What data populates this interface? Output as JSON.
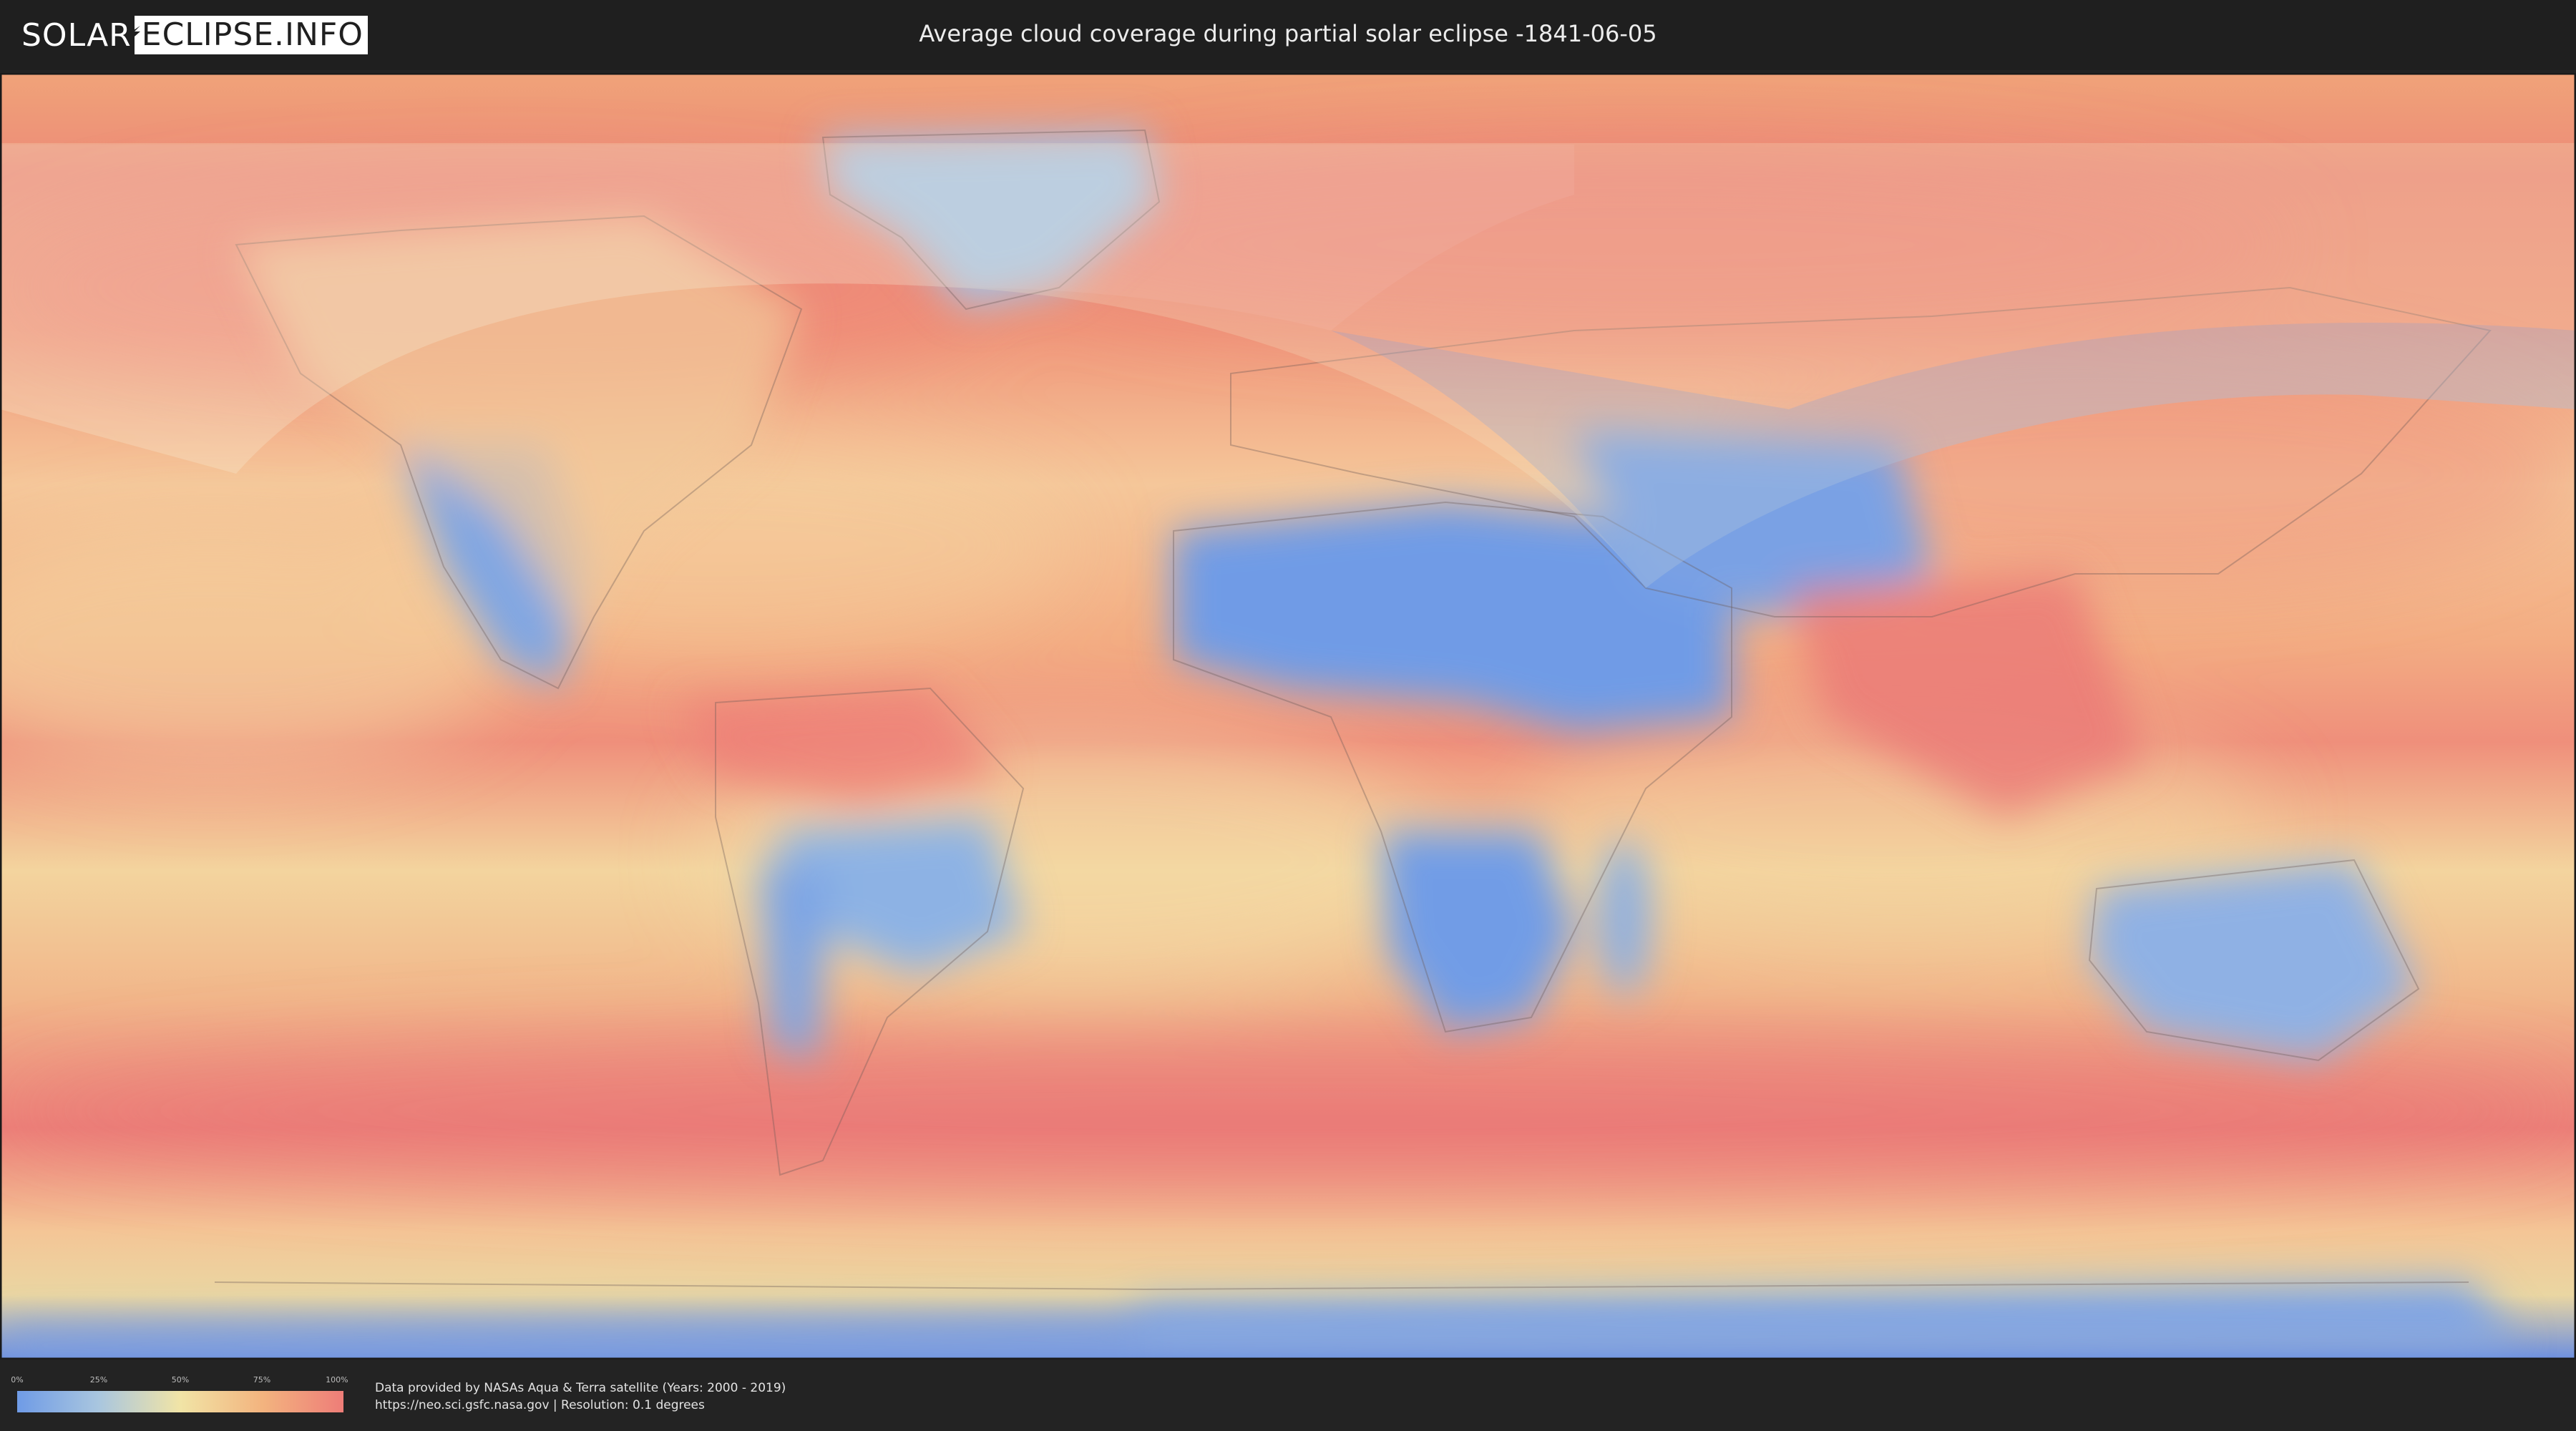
{
  "header": {
    "logo_left": "SOLAR",
    "logo_right": "ECLIPSE.INFO",
    "title": "Average cloud coverage during partial solar eclipse -1841-06-05"
  },
  "map": {
    "palette": {
      "clear": "#6f9be6",
      "low": "#a9c6df",
      "mid": "#f1e4a6",
      "high": "#f3b47f",
      "overcast": "#ee7d78",
      "polar_water": "#5a7fe0"
    },
    "eclipse_overlay_color": "#f4f1d0"
  },
  "legend": {
    "ticks": [
      {
        "label": "0%",
        "value": 0
      },
      {
        "label": "25%",
        "value": 25
      },
      {
        "label": "50%",
        "value": 50
      },
      {
        "label": "75%",
        "value": 75
      },
      {
        "label": "100%",
        "value": 100
      }
    ]
  },
  "credits": {
    "line1": "Data provided by NASAs Aqua & Terra satellite (Years: 2000 - 2019)",
    "line2": "https://neo.sci.gsfc.nasa.gov | Resolution: 0.1 degrees"
  }
}
